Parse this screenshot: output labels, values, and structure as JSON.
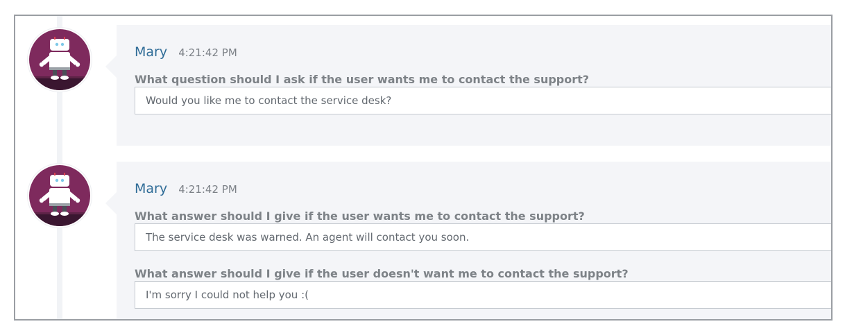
{
  "messages": [
    {
      "author": "Mary",
      "time": "4:21:42 PM",
      "fields": [
        {
          "label": "What question should I ask if the user wants me to contact the support?",
          "value": "Would you like me to contact the service desk?"
        }
      ]
    },
    {
      "author": "Mary",
      "time": "4:21:42 PM",
      "fields": [
        {
          "label": "What answer should I give if the user wants me to contact the support?",
          "value": "The service desk was warned. An agent will contact you soon."
        },
        {
          "label": "What answer should I give if the user doesn't want me to contact the support?",
          "value": "I'm sorry I could not help you :("
        }
      ]
    }
  ],
  "colors": {
    "author": "#2f6c97",
    "avatar_background": "#7e2a5d",
    "card_background": "#f4f5f8"
  },
  "icons": {
    "avatar": "robot-avatar-icon"
  }
}
